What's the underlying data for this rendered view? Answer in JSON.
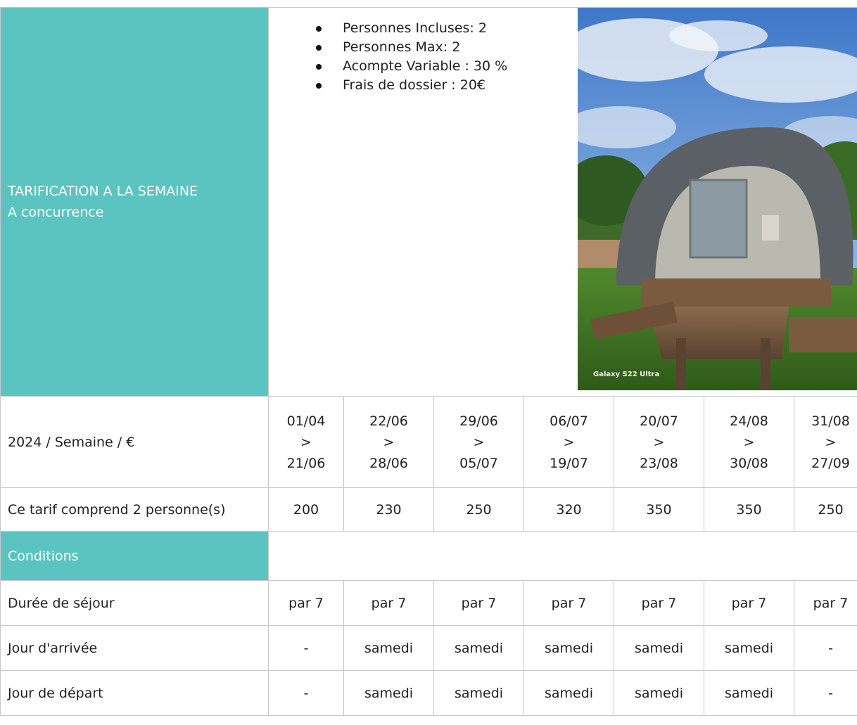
{
  "header": {
    "title_line1": "TARIFICATION A LA SEMAINE",
    "title_line2": "A concurrence"
  },
  "info": {
    "bullets": [
      "Personnes Incluses: 2",
      "Personnes Max: 2",
      "Acompte Variable : 30 %",
      "Frais de dossier : 20€"
    ],
    "photo_watermark": "Galaxy S22 Ultra"
  },
  "table": {
    "season_label": "2024 / Semaine / €",
    "periods": [
      {
        "from": "01/04",
        "sep": ">",
        "to": "21/06"
      },
      {
        "from": "22/06",
        "sep": ">",
        "to": "28/06"
      },
      {
        "from": "29/06",
        "sep": ">",
        "to": "05/07"
      },
      {
        "from": "06/07",
        "sep": ">",
        "to": "19/07"
      },
      {
        "from": "20/07",
        "sep": ">",
        "to": "23/08"
      },
      {
        "from": "24/08",
        "sep": ">",
        "to": "30/08"
      },
      {
        "from": "31/08",
        "sep": ">",
        "to": "27/09"
      }
    ],
    "price_label": "Ce tarif comprend 2 personne(s)",
    "prices": [
      "200",
      "230",
      "250",
      "320",
      "350",
      "350",
      "250"
    ],
    "conditions_label": "Conditions",
    "duration_label": "Durée de séjour",
    "durations": [
      "par 7",
      "par 7",
      "par 7",
      "par 7",
      "par 7",
      "par 7",
      "par 7"
    ],
    "arrival_label": "Jour d'arrivée",
    "arrivals": [
      "-",
      "samedi",
      "samedi",
      "samedi",
      "samedi",
      "samedi",
      "-"
    ],
    "departure_label": "Jour de départ",
    "departures": [
      "-",
      "samedi",
      "samedi",
      "samedi",
      "samedi",
      "samedi",
      "-"
    ]
  },
  "colors": {
    "accent_teal": "#5bc4c0",
    "border": "#c8c8c8"
  }
}
